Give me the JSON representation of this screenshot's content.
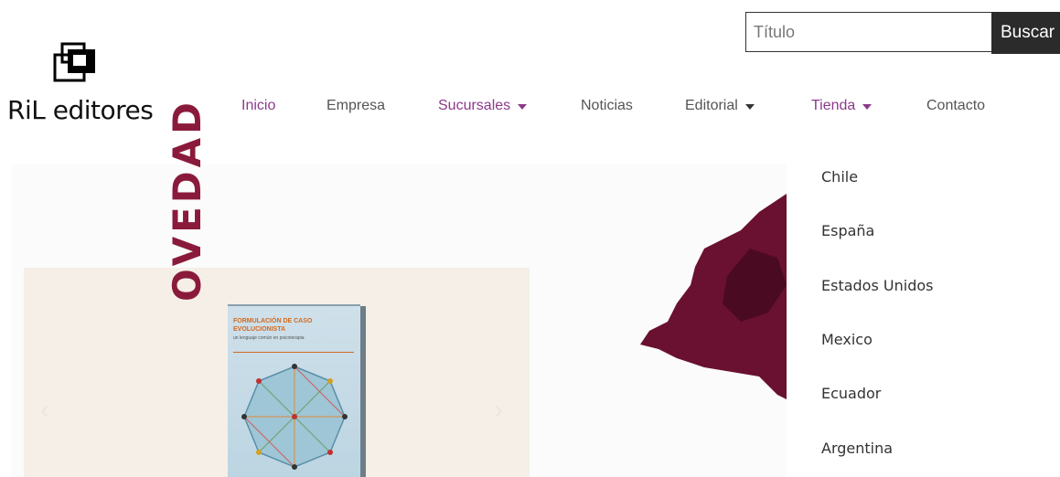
{
  "header": {
    "logo_text": "RiL editores",
    "search": {
      "placeholder": "Título",
      "button_label": "Buscar"
    }
  },
  "nav": {
    "items": [
      {
        "label": "Inicio",
        "has_caret": false
      },
      {
        "label": "Empresa",
        "has_caret": false
      },
      {
        "label": "Sucursales",
        "has_caret": true
      },
      {
        "label": "Noticias",
        "has_caret": false
      },
      {
        "label": "Editorial",
        "has_caret": true
      },
      {
        "label": "Tienda",
        "has_caret": true
      },
      {
        "label": "Contacto",
        "has_caret": false
      }
    ]
  },
  "dropdown": {
    "items": [
      "Chile",
      "España",
      "Estados Unidos",
      "Mexico",
      "Ecuador",
      "Argentina"
    ]
  },
  "hero": {
    "novedad_text": "OVEDAD",
    "book_title": "FORMULACIÓN DE CASO EVOLUCIONISTA",
    "book_subtitle": "un lenguaje común en psicoterapia",
    "prev_arrow": "‹",
    "next_arrow": "›"
  },
  "colors": {
    "nav_purple": "#8b3a8b",
    "search_button_bg": "#2b2b2b",
    "novedad_red": "#8a1a3b",
    "tree_maroon": "#6a1030"
  }
}
